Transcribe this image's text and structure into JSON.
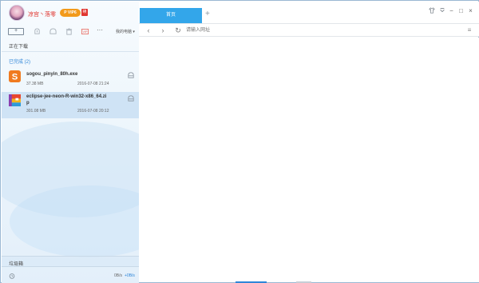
{
  "user": {
    "name": "凉宫丶落零",
    "vip_badge": "P VIP6",
    "badge": "续"
  },
  "toolbar": {
    "new_label": "+",
    "more_label": "···",
    "my_pc_label": "我的电脑 ▾"
  },
  "sections": {
    "downloading": "正在下载",
    "completed": "已完成 (2)"
  },
  "files": [
    {
      "name": "sogou_pinyin_80h.exe",
      "size": "37.38 MB",
      "date": "2016-07-08 21:24",
      "icon": "sogou-icon"
    },
    {
      "name_line1": "eclipse-jee-neon-R-win32-x86_64.zi",
      "name_line2": "p",
      "size": "301.08 MB",
      "date": "2016-07-08 20:12",
      "icon": "archive-icon"
    }
  ],
  "trash": {
    "label": "垃圾箱"
  },
  "status": {
    "down_speed": "0B/s",
    "up_speed": "+0B/s"
  },
  "browser": {
    "tab_label": "首页",
    "new_tab": "+",
    "url_placeholder": "请输入网址",
    "back": "‹",
    "forward": "›",
    "refresh": "↻",
    "menu": "≡"
  },
  "window": {
    "skin": "shirt-icon",
    "settings": "menu-down-icon",
    "minimize": "−",
    "maximize": "□",
    "close": "×"
  },
  "colors": {
    "accent": "#2f86d8",
    "tab_active": "#33a6ea",
    "username": "#e0352f",
    "vip": "#f29a1b"
  }
}
